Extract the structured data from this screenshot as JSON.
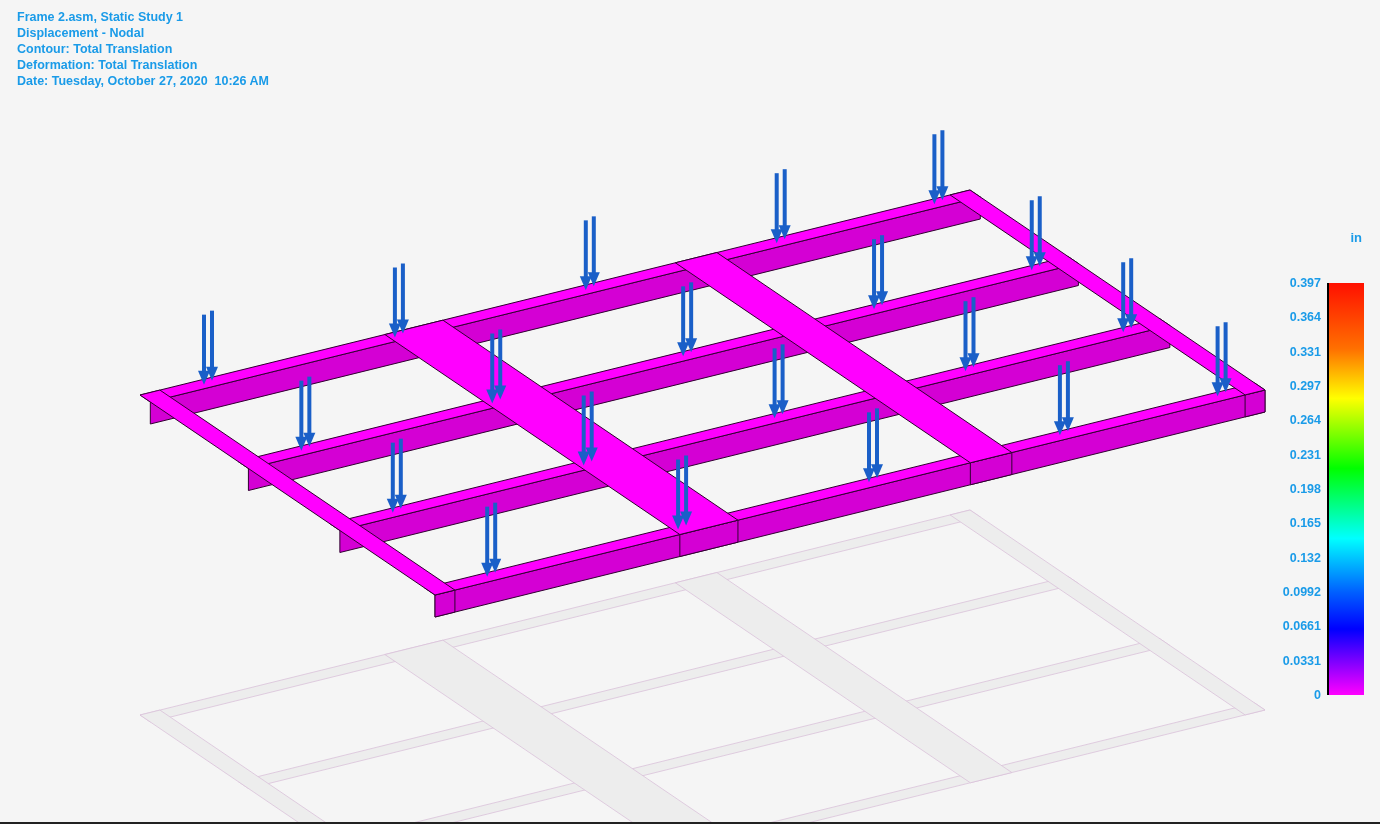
{
  "header_lines": [
    "Frame 2.asm, Static Study 1",
    "Displacement - Nodal",
    "Contour: Total Translation",
    "Deformation: Total Translation",
    "Date: Tuesday, October 27, 2020  10:26 AM"
  ],
  "legend": {
    "unit": "in",
    "ticks": [
      "0.397",
      "0.364",
      "0.331",
      "0.297",
      "0.264",
      "0.231",
      "0.198",
      "0.165",
      "0.132",
      "0.0992",
      "0.0661",
      "0.0331",
      "0"
    ]
  }
}
